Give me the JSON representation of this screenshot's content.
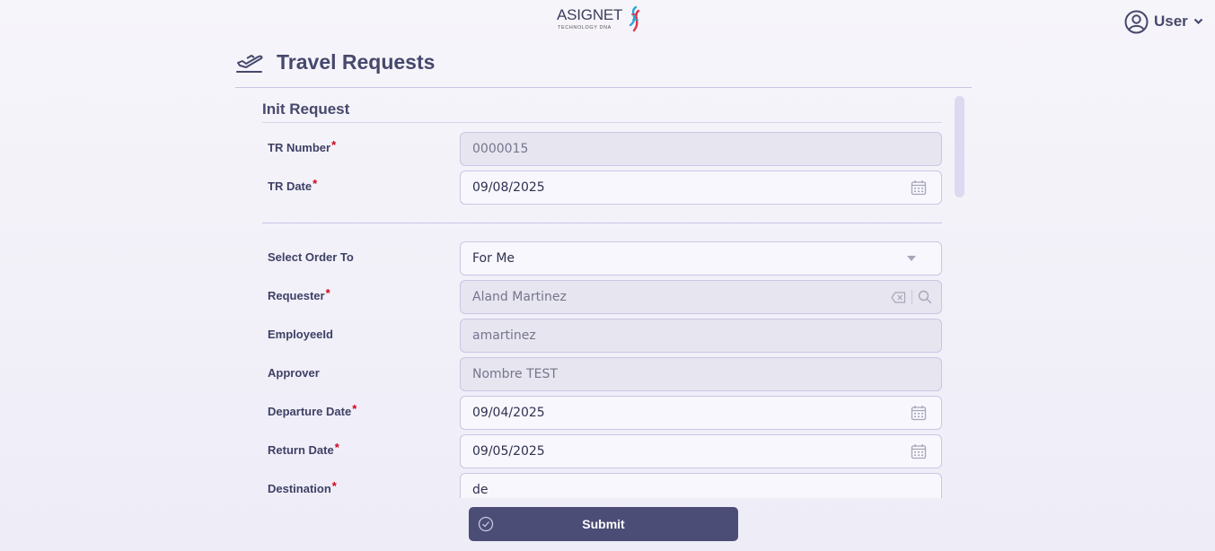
{
  "brand": {
    "name": "ASIGNET",
    "tagline": "TECHNOLOGY DNA",
    "icon": "dna-logo-icon"
  },
  "user_menu": {
    "label": "User",
    "icon": "user-circle-icon",
    "caret": "chevron-down-icon"
  },
  "page": {
    "title": "Travel Requests",
    "icon": "airplane-takeoff-icon"
  },
  "section": {
    "title": "Init Request"
  },
  "form": {
    "tr_number": {
      "label": "TR Number",
      "required": "*",
      "value": "0000015"
    },
    "tr_date": {
      "label": "TR Date",
      "required": "*",
      "value": "09/08/2025",
      "icon": "calendar-icon"
    },
    "order_to": {
      "label": "Select Order To",
      "value": "For Me",
      "icon": "caret-down-icon"
    },
    "requester": {
      "label": "Requester",
      "required": "*",
      "value": "Aland Martinez",
      "icons": [
        "clear-icon",
        "search-icon"
      ]
    },
    "employee_id": {
      "label": "EmployeeId",
      "value": "amartinez"
    },
    "approver": {
      "label": "Approver",
      "value": "Nombre TEST"
    },
    "departure_date": {
      "label": "Departure Date",
      "required": "*",
      "value": "09/04/2025",
      "icon": "calendar-icon"
    },
    "return_date": {
      "label": "Return Date",
      "required": "*",
      "value": "09/05/2025",
      "icon": "calendar-icon"
    },
    "destination": {
      "label": "Destination",
      "required": "*",
      "value": "de"
    }
  },
  "actions": {
    "submit_label": "Submit",
    "submit_icon": "check-circle-icon"
  },
  "colors": {
    "primary": "#4b4d76",
    "required": "#d0021b",
    "border": "#c9c6e4",
    "readonly_bg": "#e7e5ef"
  }
}
